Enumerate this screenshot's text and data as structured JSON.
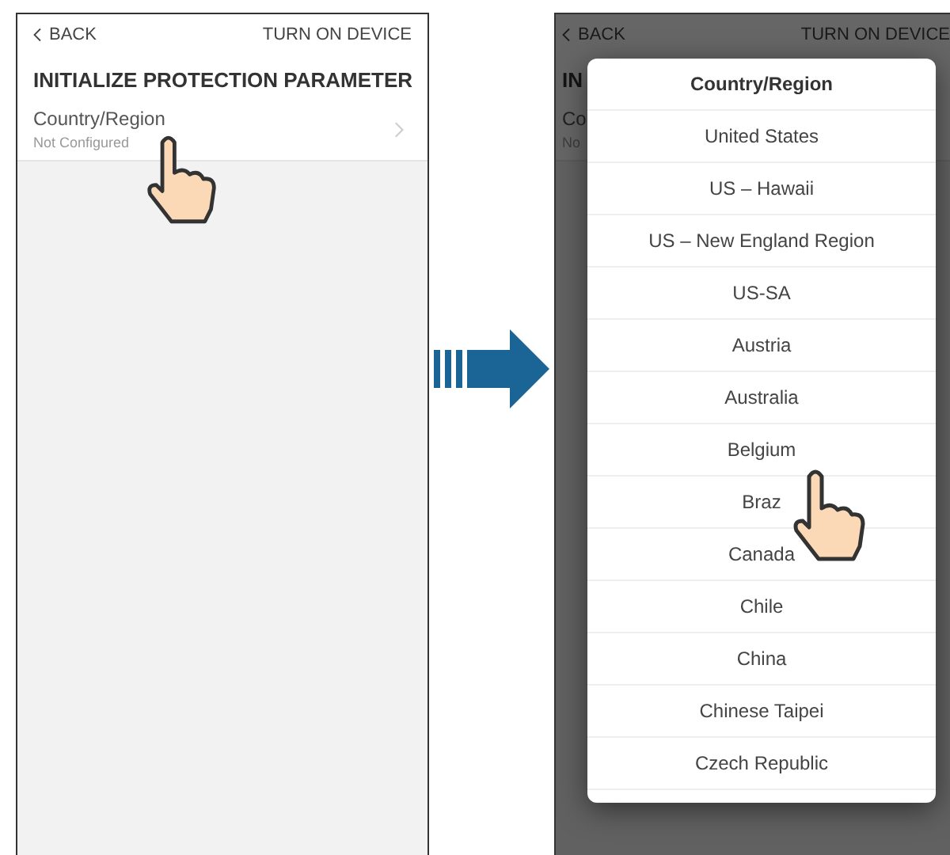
{
  "left_screen": {
    "back": "BACK",
    "action": "TURN ON DEVICE",
    "title": "INITIALIZE PROTECTION PARAMETER",
    "setting": {
      "label": "Country/Region",
      "value": "Not Configured"
    }
  },
  "right_screen": {
    "back": "BACK",
    "action": "TURN ON DEVICE",
    "title_fragment": "IN",
    "label_fragment": "Co",
    "value_fragment": "No",
    "dialog": {
      "title": "Country/Region",
      "options": [
        "United States",
        "US – Hawaii",
        "US – New England Region",
        "US-SA",
        "Austria",
        "Australia",
        "Belgium",
        "Braz",
        "Canada",
        "Chile",
        "China",
        "Chinese Taipei",
        "Czech Republic"
      ]
    }
  }
}
